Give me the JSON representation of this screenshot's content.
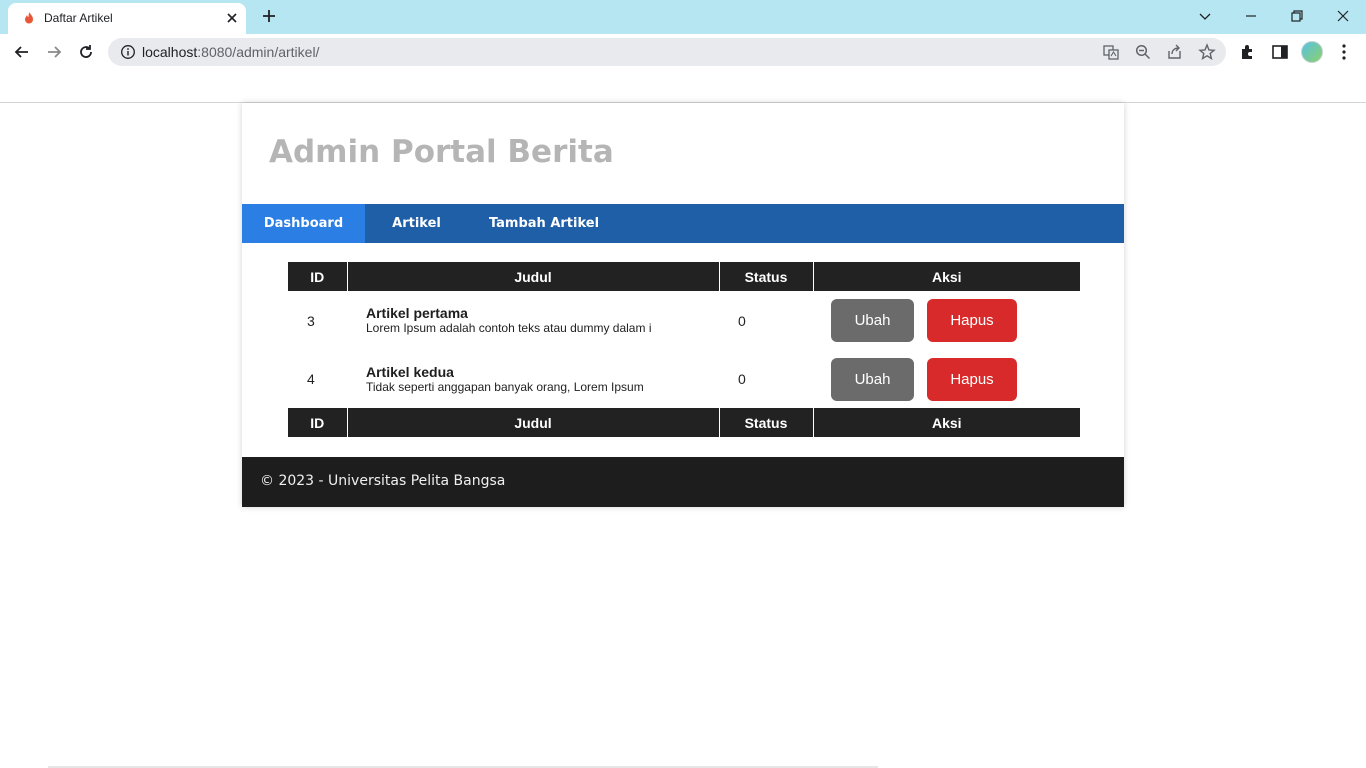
{
  "browser": {
    "tab_title": "Daftar Artikel",
    "url_host": "localhost",
    "url_rest": ":8080/admin/artikel/",
    "icons": [
      "favicon-flame-icon",
      "close-icon",
      "plus-icon",
      "chevron-down-icon",
      "minimize-icon",
      "restore-icon",
      "close-window-icon",
      "back-icon",
      "forward-icon",
      "reload-icon",
      "info-icon",
      "translate-icon",
      "zoom-icon",
      "share-icon",
      "star-icon",
      "extensions-icon",
      "sidepanel-icon",
      "profile-avatar",
      "kebab-menu-icon"
    ]
  },
  "site": {
    "title": "Admin Portal Berita"
  },
  "nav": {
    "items": [
      {
        "label": "Dashboard",
        "active": true
      },
      {
        "label": "Artikel",
        "active": false
      },
      {
        "label": "Tambah Artikel",
        "active": false
      }
    ]
  },
  "table": {
    "headers": [
      "ID",
      "Judul",
      "Status",
      "Aksi"
    ],
    "rows": [
      {
        "id": "3",
        "title": "Artikel pertama",
        "excerpt": "Lorem Ipsum adalah contoh teks atau dummy dalam i",
        "status": "0",
        "edit": "Ubah",
        "delete": "Hapus"
      },
      {
        "id": "4",
        "title": "Artikel kedua",
        "excerpt": "Tidak seperti anggapan banyak orang, Lorem Ipsum",
        "status": "0",
        "edit": "Ubah",
        "delete": "Hapus"
      }
    ],
    "footer_headers": [
      "ID",
      "Judul",
      "Status",
      "Aksi"
    ]
  },
  "footer": {
    "text": "© 2023 - Universitas Pelita Bangsa"
  },
  "colors": {
    "tabstrip": "#b6e6f2",
    "nav": "#1f5fa8",
    "nav_active": "#2a7ee4",
    "header_row": "#222222",
    "btn_ubah": "#6b6b6b",
    "btn_hapus": "#d82a2a",
    "footer": "#1d1d1d",
    "title": "#b5b5b5"
  }
}
